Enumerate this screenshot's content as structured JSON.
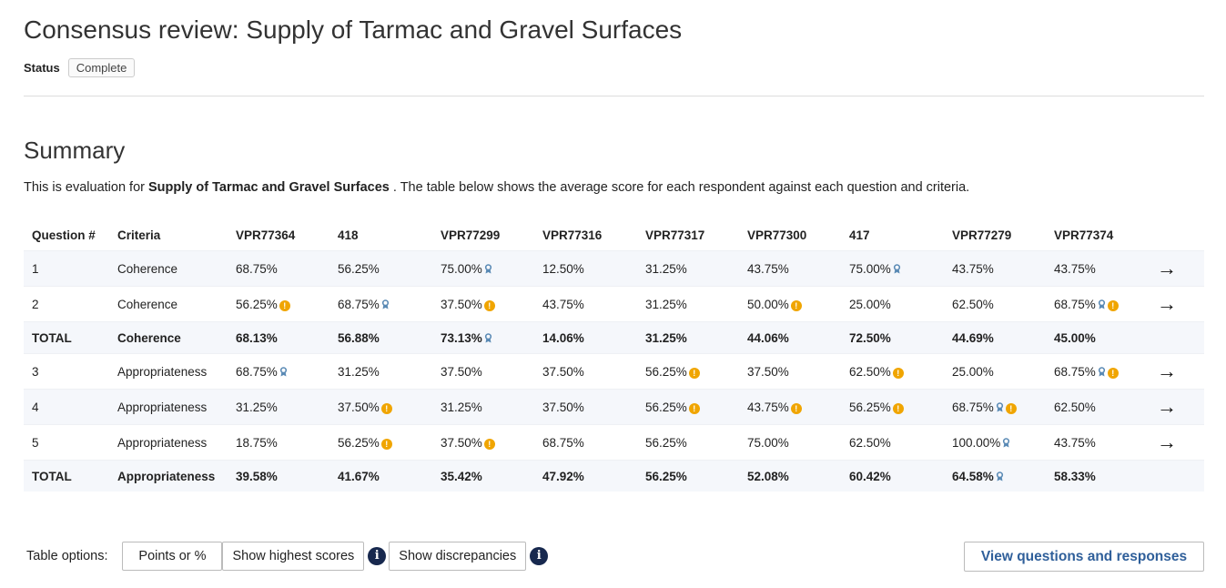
{
  "header": {
    "title": "Consensus review: Supply of Tarmac and Gravel Surfaces",
    "status_label": "Status",
    "status_value": "Complete"
  },
  "summary": {
    "heading": "Summary",
    "intro_before": "This is evaluation for ",
    "intro_bold": "Supply of Tarmac and Gravel Surfaces",
    "intro_after": " . The table below shows the average score for each respondent against each question and criteria."
  },
  "icons": {
    "medal": "medal-icon",
    "warning": "warning-icon",
    "arrow": "arrow-right-icon",
    "info": "info-icon"
  },
  "colors": {
    "warning": "#f0a500",
    "medal": "#5a8ab5",
    "info": "#17284e",
    "link": "#2f5f9a"
  },
  "table": {
    "headers": [
      "Question #",
      "Criteria",
      "VPR77364",
      "418",
      "VPR77299",
      "VPR77316",
      "VPR77317",
      "VPR77300",
      "417",
      "VPR77279",
      "VPR77374"
    ],
    "rows": [
      {
        "q": "1",
        "criteria": "Coherence",
        "total": false,
        "arrow": true,
        "cells": [
          {
            "v": "68.75%"
          },
          {
            "v": "56.25%"
          },
          {
            "v": "75.00%",
            "medal": true
          },
          {
            "v": "12.50%"
          },
          {
            "v": "31.25%"
          },
          {
            "v": "43.75%"
          },
          {
            "v": "75.00%",
            "medal": true
          },
          {
            "v": "43.75%"
          },
          {
            "v": "43.75%"
          }
        ]
      },
      {
        "q": "2",
        "criteria": "Coherence",
        "total": false,
        "arrow": true,
        "cells": [
          {
            "v": "56.25%",
            "warn": true
          },
          {
            "v": "68.75%",
            "medal": true
          },
          {
            "v": "37.50%",
            "warn": true
          },
          {
            "v": "43.75%"
          },
          {
            "v": "31.25%"
          },
          {
            "v": "50.00%",
            "warn": true
          },
          {
            "v": "25.00%"
          },
          {
            "v": "62.50%"
          },
          {
            "v": "68.75%",
            "medal": true,
            "warn": true
          }
        ]
      },
      {
        "q": "TOTAL",
        "criteria": "Coherence",
        "total": true,
        "arrow": false,
        "cells": [
          {
            "v": "68.13%"
          },
          {
            "v": "56.88%"
          },
          {
            "v": "73.13%",
            "medal": true
          },
          {
            "v": "14.06%"
          },
          {
            "v": "31.25%"
          },
          {
            "v": "44.06%"
          },
          {
            "v": "72.50%"
          },
          {
            "v": "44.69%"
          },
          {
            "v": "45.00%"
          }
        ]
      },
      {
        "q": "3",
        "criteria": "Appropriateness",
        "total": false,
        "arrow": true,
        "cells": [
          {
            "v": "68.75%",
            "medal": true
          },
          {
            "v": "31.25%"
          },
          {
            "v": "37.50%"
          },
          {
            "v": "37.50%"
          },
          {
            "v": "56.25%",
            "warn": true
          },
          {
            "v": "37.50%"
          },
          {
            "v": "62.50%",
            "warn": true
          },
          {
            "v": "25.00%"
          },
          {
            "v": "68.75%",
            "medal": true,
            "warn": true
          }
        ]
      },
      {
        "q": "4",
        "criteria": "Appropriateness",
        "total": false,
        "arrow": true,
        "cells": [
          {
            "v": "31.25%"
          },
          {
            "v": "37.50%",
            "warn": true
          },
          {
            "v": "31.25%"
          },
          {
            "v": "37.50%"
          },
          {
            "v": "56.25%",
            "warn": true
          },
          {
            "v": "43.75%",
            "warn": true
          },
          {
            "v": "56.25%",
            "warn": true
          },
          {
            "v": "68.75%",
            "medal": true,
            "warn": true
          },
          {
            "v": "62.50%"
          }
        ]
      },
      {
        "q": "5",
        "criteria": "Appropriateness",
        "total": false,
        "arrow": true,
        "cells": [
          {
            "v": "18.75%"
          },
          {
            "v": "56.25%",
            "warn": true
          },
          {
            "v": "37.50%",
            "warn": true
          },
          {
            "v": "68.75%"
          },
          {
            "v": "56.25%"
          },
          {
            "v": "75.00%"
          },
          {
            "v": "62.50%"
          },
          {
            "v": "100.00%",
            "medal": true
          },
          {
            "v": "43.75%"
          }
        ]
      },
      {
        "q": "TOTAL",
        "criteria": "Appropriateness",
        "total": true,
        "arrow": false,
        "cells": [
          {
            "v": "39.58%"
          },
          {
            "v": "41.67%"
          },
          {
            "v": "35.42%"
          },
          {
            "v": "47.92%"
          },
          {
            "v": "56.25%"
          },
          {
            "v": "52.08%"
          },
          {
            "v": "60.42%"
          },
          {
            "v": "64.58%",
            "medal": true
          },
          {
            "v": "58.33%"
          }
        ]
      }
    ]
  },
  "options": {
    "label": "Table options:",
    "points_button": "Points or %",
    "highest_button": "Show highest scores",
    "discrepancies_button": "Show discrepancies",
    "view_button": "View questions and responses"
  }
}
